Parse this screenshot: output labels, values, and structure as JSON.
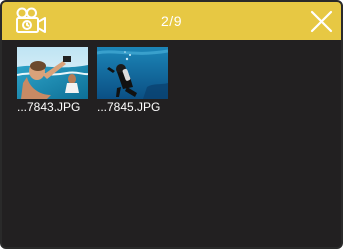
{
  "header": {
    "mode_icon": "video-camera-timer-icon",
    "counter": "2/9",
    "close_icon": "close-icon",
    "accent_color": "#e7c843"
  },
  "files": [
    {
      "name": "...7843.JPG",
      "thumbnail": "selfie-with-surf"
    },
    {
      "name": "...7845.JPG",
      "thumbnail": "scuba-diver-underwater"
    }
  ]
}
